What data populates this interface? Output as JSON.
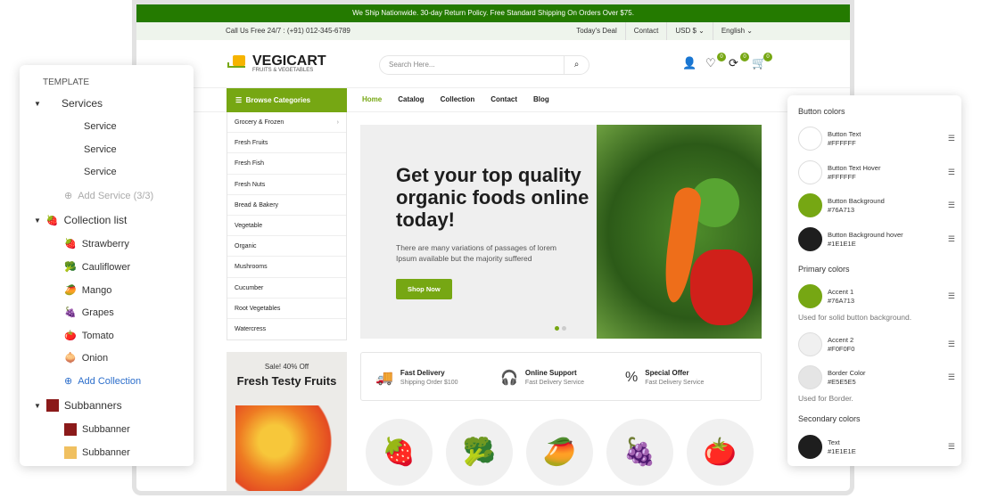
{
  "store": {
    "promo": "We Ship Nationwide. 30-day Return Policy. Free Standard Shipping On Orders Over $75.",
    "call": "Call Us Free 24/7 : (+91) 012-345-6789",
    "top_links": [
      "Today's Deal",
      "Contact",
      "USD $ ⌄",
      "English ⌄"
    ],
    "logo_name": "VEGICART",
    "logo_tag": "FRUITS & VEGETABLES",
    "search_placeholder": "Search Here...",
    "counts": {
      "wishlist": "0",
      "compare": "0",
      "cart": "0"
    },
    "browse": "Browse Categories",
    "menu": [
      "Home",
      "Catalog",
      "Collection",
      "Contact",
      "Blog"
    ],
    "categories": [
      "Grocery & Frozen",
      "Fresh Fruits",
      "Fresh Fish",
      "Fresh Nuts",
      "Bread & Bakery",
      "Vegetable",
      "Organic",
      "Mushrooms",
      "Cucumber",
      "Root Vegetables",
      "Watercress"
    ],
    "hero": {
      "title": "Get your top quality organic foods online today!",
      "text": "There are many variations of passages of lorem Ipsum available but the majority suffered",
      "button": "Shop Now"
    },
    "features": [
      {
        "title": "Fast Delivery",
        "sub": "Shipping Order $100"
      },
      {
        "title": "Online Support",
        "sub": "Fast Delivery Service"
      },
      {
        "title": "Special Offer",
        "sub": "Fast Delivery Service"
      }
    ],
    "banner": {
      "sale": "Sale! 40% Off",
      "title": "Fresh Testy Fruits"
    },
    "accent": "#76A713"
  },
  "left_panel": {
    "title": "TEMPLATE",
    "services": "Services",
    "service_items": [
      "Service",
      "Service",
      "Service"
    ],
    "add_service": "Add Service (3/3)",
    "collection": "Collection list",
    "collection_items": [
      "Strawberry",
      "Cauliflower",
      "Mango",
      "Grapes",
      "Tomato",
      "Onion"
    ],
    "add_collection": "Add Collection",
    "subbanners": "Subbanners",
    "subbanner_items": [
      "Subbanner",
      "Subbanner"
    ]
  },
  "right_panel": {
    "button_colors": "Button colors",
    "buttons": [
      {
        "name": "Button Text",
        "hex": "#FFFFFF"
      },
      {
        "name": "Button Text Hover",
        "hex": "#FFFFFF"
      },
      {
        "name": "Button Background",
        "hex": "#76A713"
      },
      {
        "name": "Button Background hover",
        "hex": "#1E1E1E"
      }
    ],
    "primary_colors": "Primary colors",
    "accent1": {
      "name": "Accent 1",
      "hex": "#76A713"
    },
    "accent1_note": "Used for solid button background.",
    "accent2": {
      "name": "Accent 2",
      "hex": "#F0F0F0"
    },
    "border": {
      "name": "Border Color",
      "hex": "#E5E5E5"
    },
    "border_note": "Used for Border.",
    "secondary_colors": "Secondary colors",
    "text": {
      "name": "Text",
      "hex": "#1E1E1E"
    }
  }
}
